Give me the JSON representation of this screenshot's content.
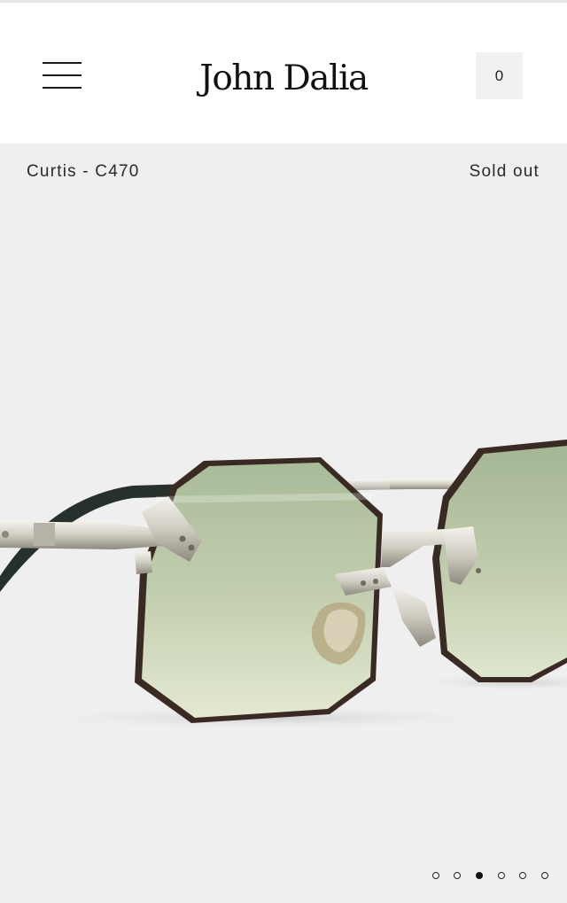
{
  "header": {
    "brand": "John Dalia",
    "cart_count": "0"
  },
  "product": {
    "title": "Curtis - C470",
    "status": "Sold out"
  },
  "gallery": {
    "slide_count": 6,
    "active_index": 2
  },
  "colors": {
    "background": "#efefef",
    "header_bg": "#ffffff",
    "lens_tint": "#b9c9a4",
    "frame_metal": "#d9d6ce",
    "lens_edge": "#3a2a24"
  }
}
